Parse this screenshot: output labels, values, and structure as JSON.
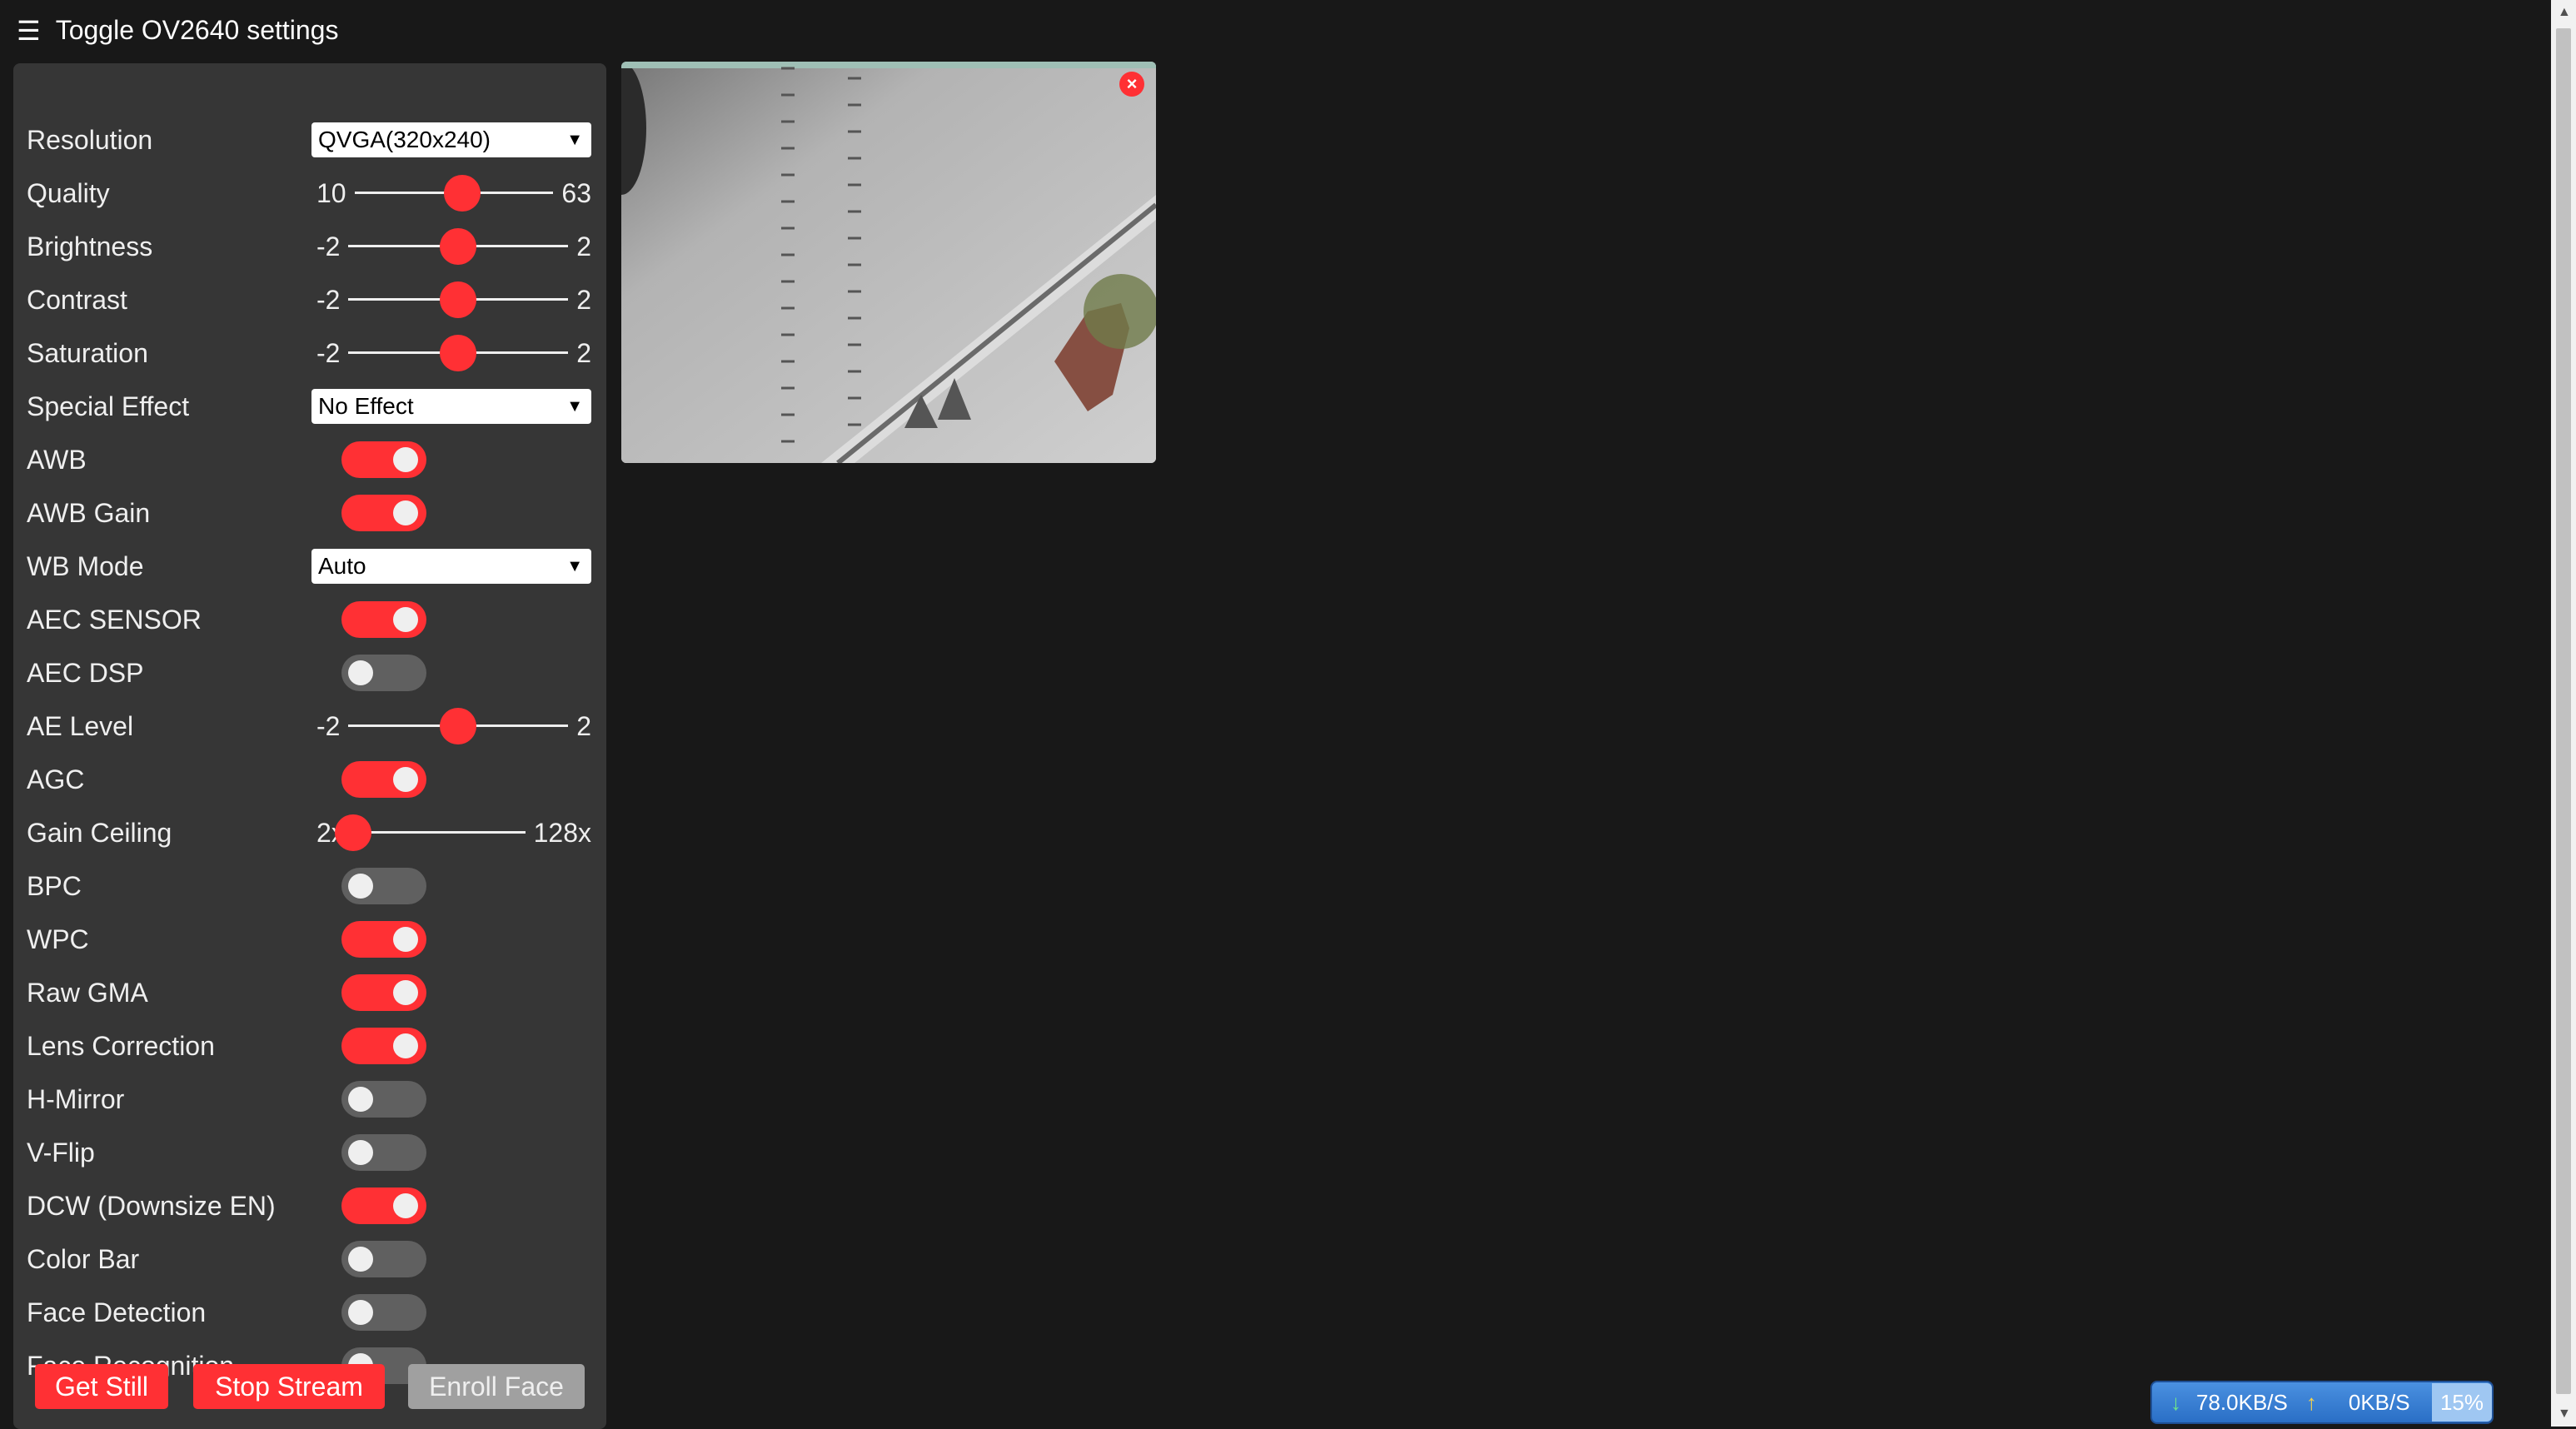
{
  "header": {
    "menu_icon": "hamburger-icon",
    "title": "Toggle OV2640 settings"
  },
  "settings": {
    "resolution": {
      "label": "Resolution",
      "value": "QVGA(320x240)"
    },
    "quality": {
      "label": "Quality",
      "min": "10",
      "max": "63",
      "value_fraction": 0.54
    },
    "brightness": {
      "label": "Brightness",
      "min": "-2",
      "max": "2",
      "value_fraction": 0.5
    },
    "contrast": {
      "label": "Contrast",
      "min": "-2",
      "max": "2",
      "value_fraction": 0.5
    },
    "saturation": {
      "label": "Saturation",
      "min": "-2",
      "max": "2",
      "value_fraction": 0.5
    },
    "special_effect": {
      "label": "Special Effect",
      "value": "No Effect"
    },
    "awb": {
      "label": "AWB",
      "on": true
    },
    "awb_gain": {
      "label": "AWB Gain",
      "on": true
    },
    "wb_mode": {
      "label": "WB Mode",
      "value": "Auto"
    },
    "aec_sensor": {
      "label": "AEC SENSOR",
      "on": true
    },
    "aec_dsp": {
      "label": "AEC DSP",
      "on": false
    },
    "ae_level": {
      "label": "AE Level",
      "min": "-2",
      "max": "2",
      "value_fraction": 0.5
    },
    "agc": {
      "label": "AGC",
      "on": true
    },
    "gain_ceiling": {
      "label": "Gain Ceiling",
      "min": "2x",
      "max": "128x",
      "value_fraction": 0.0
    },
    "bpc": {
      "label": "BPC",
      "on": false
    },
    "wpc": {
      "label": "WPC",
      "on": true
    },
    "raw_gma": {
      "label": "Raw GMA",
      "on": true
    },
    "lens_correction": {
      "label": "Lens Correction",
      "on": true
    },
    "h_mirror": {
      "label": "H-Mirror",
      "on": false
    },
    "v_flip": {
      "label": "V-Flip",
      "on": false
    },
    "dcw": {
      "label": "DCW (Downsize EN)",
      "on": true
    },
    "color_bar": {
      "label": "Color Bar",
      "on": false
    },
    "face_detection": {
      "label": "Face Detection",
      "on": false
    },
    "face_recognition": {
      "label": "Face Recognition",
      "on": false
    }
  },
  "buttons": {
    "get_still": "Get Still",
    "stop_stream": "Stop Stream",
    "enroll_face": "Enroll Face"
  },
  "stream": {
    "close_label": "×"
  },
  "netspeed": {
    "download": "78.0KB/S",
    "upload": "0KB/S",
    "percent": "15%"
  },
  "colors": {
    "accent": "#ff3034",
    "panel_bg": "#363636",
    "page_bg": "#181818",
    "toggle_off": "#606060"
  }
}
